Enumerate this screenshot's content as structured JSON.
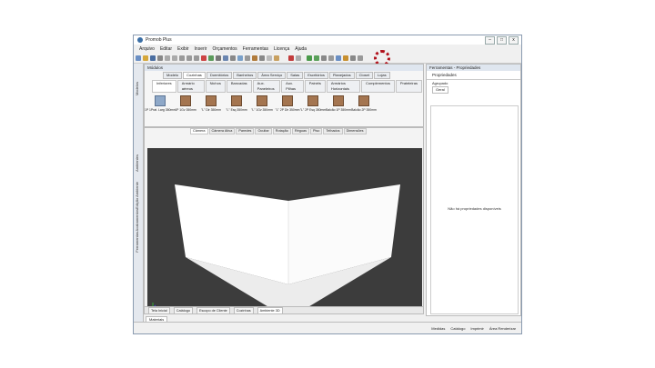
{
  "app": {
    "title": "Promob Plus"
  },
  "window_buttons": {
    "minimize": "–",
    "maximize": "□",
    "close": "x"
  },
  "menu": [
    "Arquivo",
    "Editar",
    "Exibir",
    "Inserir",
    "Orçamentos",
    "Ferramentas",
    "Licença",
    "Ajuda"
  ],
  "left_strip": [
    "Modelos",
    "Ambientes",
    "Edição Ambiente",
    "Acabamentos",
    "Ferramentas"
  ],
  "modules_panel": {
    "title": "Módulos",
    "category_tabs": [
      "Modelo",
      "Cozinhas",
      "Dormitórios",
      "Banheiros",
      "Área Serviço",
      "Salas",
      "Escritórios",
      "Planejados",
      "Closet",
      "Lojas"
    ],
    "category_selected": 1,
    "sub_tabs": [
      "Inferiores",
      "Armário aéreos",
      "Nichos",
      "Bancadas",
      "Aux. Paneleiros",
      "Aux. Pilhas",
      "Painéis",
      "Armários Horizontais",
      "Complementos",
      "Prateleiras"
    ],
    "sub_selected": 0,
    "items": [
      {
        "label": "1P 1Prat. Larg 350mm",
        "blue": true
      },
      {
        "label": "1P 1Gv 350mm",
        "blue": false
      },
      {
        "label": "\"L\" Dir 350mm",
        "blue": false
      },
      {
        "label": "\"L\" Esq 350mm",
        "blue": false
      },
      {
        "label": "\"L\" 1Gv 350mm",
        "blue": false
      },
      {
        "label": "\"L\" 2P Dir 350mm",
        "blue": false
      },
      {
        "label": "\"L\" 2P Esq 350mm",
        "blue": false
      },
      {
        "label": "Balcão 1P 350mm",
        "blue": false
      },
      {
        "label": "Balcão 2P 350mm",
        "blue": false
      }
    ]
  },
  "view_tabs": [
    "Câmera",
    "Câmera Ativa",
    "Paredes",
    "Ocultar",
    "Rotação",
    "Réguas",
    "Piso",
    "Telhados",
    "Dimensões"
  ],
  "view_selected": 0,
  "bottom_tabs": [
    "Tela Inicial",
    "Catálogo",
    "Escopo de Cliente",
    "Cozinhas",
    "Ambiente 3D"
  ],
  "bottom_selected": 4,
  "materials_tab": "Materiais",
  "properties_panel": {
    "title": "Ferramentas - Propriedades",
    "subtitle": "Propriedades",
    "toolbar_label": "Agrupado",
    "tab": "Geral",
    "empty_text": "Não há propriedades disponíveis"
  },
  "status_bar": [
    "Medidas",
    "Catálogo",
    "Imprimir",
    "Área Renderizar"
  ],
  "colors": {
    "highlight": "#b0101a",
    "canvas": "#3c3c3c",
    "wall": "#ffffff",
    "floor": "#efefef"
  }
}
